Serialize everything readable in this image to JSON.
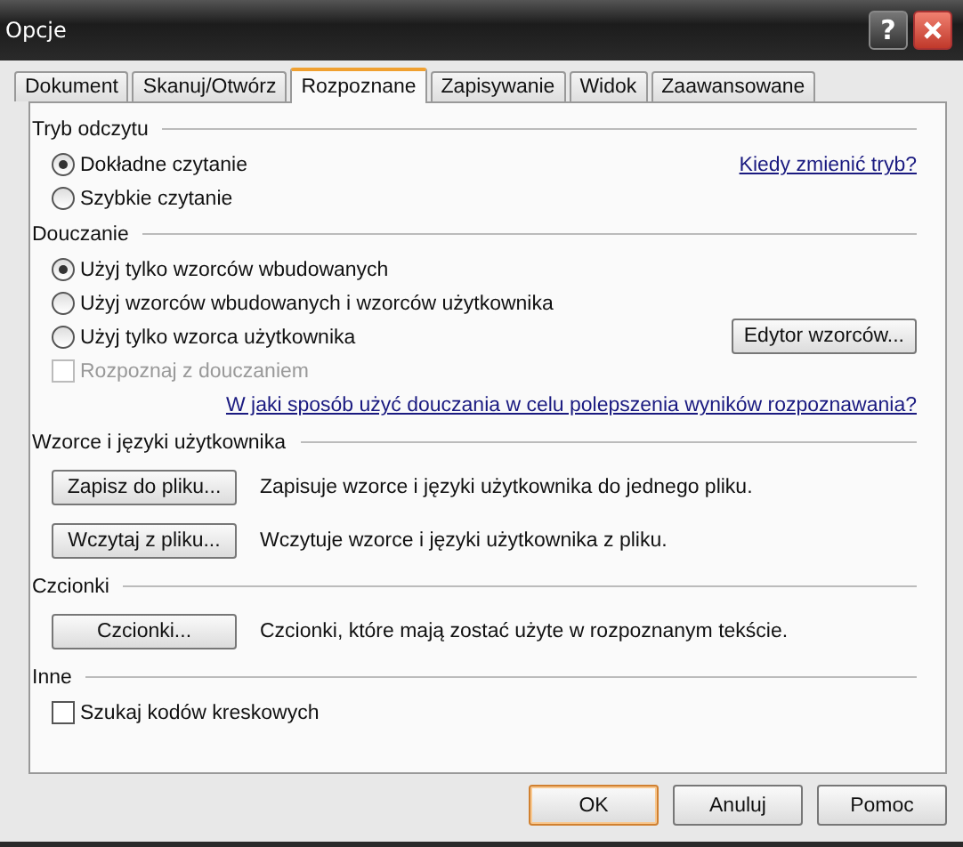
{
  "window": {
    "title": "Opcje",
    "help_button": "?"
  },
  "tabs": [
    {
      "label": "Dokument",
      "selected": false
    },
    {
      "label": "Skanuj/Otwórz",
      "selected": false
    },
    {
      "label": "Rozpoznane",
      "selected": true
    },
    {
      "label": "Zapisywanie",
      "selected": false
    },
    {
      "label": "Widok",
      "selected": false
    },
    {
      "label": "Zaawansowane",
      "selected": false
    }
  ],
  "sections": [
    {
      "kind": "radio",
      "title": "Tryb odczytu",
      "options": [
        {
          "label": "Dokładne czytanie",
          "selected": true
        },
        {
          "label": "Szybkie czytanie",
          "selected": false
        }
      ],
      "side": {
        "kind": "link",
        "label": "Kiedy zmienić tryb?"
      }
    },
    {
      "kind": "radio",
      "title": "Douczanie",
      "options": [
        {
          "label": "Użyj tylko wzorców wbudowanych",
          "selected": true
        },
        {
          "label": "Użyj wzorców wbudowanych i wzorców użytkownika",
          "selected": false
        },
        {
          "label": "Użyj tylko wzorca użytkownika",
          "selected": false
        }
      ],
      "side": {
        "kind": "button",
        "label": "Edytor wzorców..."
      },
      "checkbox": {
        "label": "Rozpoznaj z douczaniem",
        "checked": false,
        "disabled": true
      },
      "link": "W jaki sposób użyć douczania w celu polepszenia wyników rozpoznawania?"
    },
    {
      "kind": "actions",
      "title": "Wzorce i języki użytkownika",
      "actions": [
        {
          "button": "Zapisz do pliku...",
          "description": "Zapisuje wzorce i języki użytkownika do jednego pliku."
        },
        {
          "button": "Wczytaj z pliku...",
          "description": "Wczytuje wzorce i języki użytkownika z pliku."
        }
      ]
    },
    {
      "kind": "actions",
      "title": "Czcionki",
      "actions": [
        {
          "button": "Czcionki...",
          "description": "Czcionki, które mają zostać użyte w rozpoznanym tekście."
        }
      ]
    },
    {
      "kind": "checks",
      "title": "Inne",
      "checkboxes": [
        {
          "label": "Szukaj kodów kreskowych",
          "checked": false,
          "disabled": false
        }
      ]
    }
  ],
  "buttons": [
    {
      "label": "OK",
      "default": true
    },
    {
      "label": "Anuluj",
      "default": false
    },
    {
      "label": "Pomoc",
      "default": false
    }
  ]
}
